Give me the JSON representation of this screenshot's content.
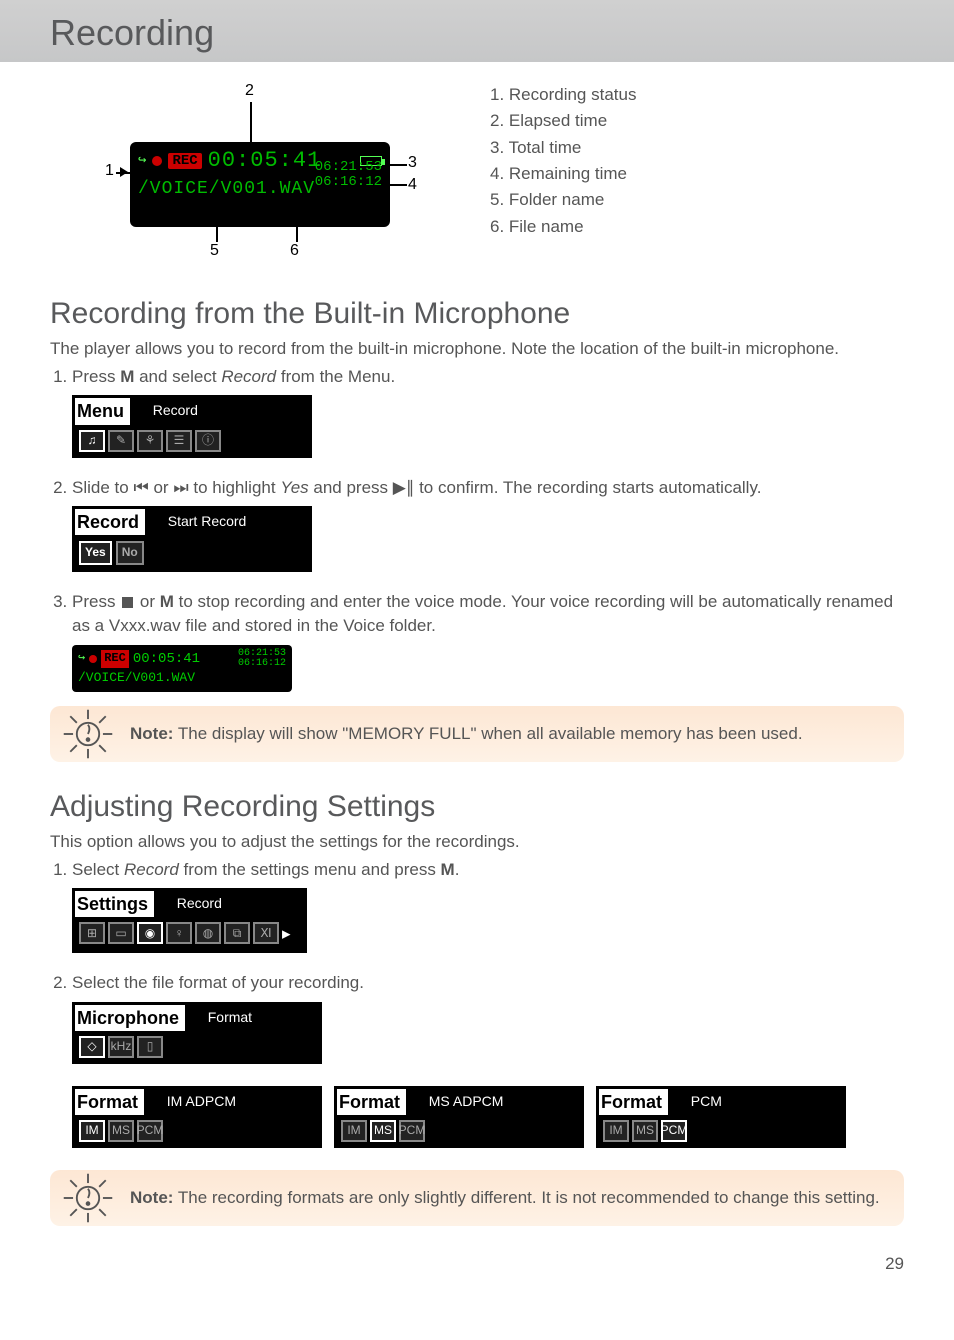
{
  "page": {
    "title": "Recording",
    "number": "29"
  },
  "diagram": {
    "callouts": {
      "c1": "1",
      "c2": "2",
      "c3": "3",
      "c4": "4",
      "c5": "5",
      "c6": "6"
    },
    "lcd": {
      "rec_badge": "REC",
      "elapsed": "00:05:41",
      "total": "06:21:53",
      "remaining": "06:16:12",
      "path": "/VOICE/V001.WAV"
    },
    "legend": {
      "i1": "1.  Recording status",
      "i2": "2.  Elapsed time",
      "i3": "3.  Total time",
      "i4": "4.  Remaining time",
      "i5": "5.  Folder name",
      "i6": "6.  File name"
    }
  },
  "section1": {
    "heading": "Recording from the Built-in Microphone",
    "intro": "The player allows you to record from the built-in microphone. Note the location of the built-in microphone.",
    "step1_a": "Press ",
    "step1_b": "M",
    "step1_c": " and select ",
    "step1_d": "Record",
    "step1_e": " from the Menu.",
    "menu_tab": "Menu",
    "menu_right": "Record",
    "step2_a": "Slide to ",
    "step2_prev": "⏮",
    "step2_or": " or ",
    "step2_next": "⏭",
    "step2_b": "  to highlight ",
    "step2_yes": "Yes",
    "step2_c": " and press ",
    "step2_play": "▶∥",
    "step2_d": " to confirm. The recording starts automatically.",
    "record_tab": "Record",
    "record_right": "Start Record",
    "yes_label": "Yes",
    "no_label": "No",
    "step3_a": "Press ",
    "step3_b": "  or ",
    "step3_m": "M",
    "step3_c": " to stop recording and enter the voice mode. Your voice recording will be automatically renamed as a Vxxx.wav file and stored in the Voice folder.",
    "note1_a": "Note:",
    "note1_b": " The display will show \"MEMORY FULL\" when all available memory has been used."
  },
  "section2": {
    "heading": "Adjusting Recording Settings",
    "intro": "This option allows you to adjust the settings for the recordings.",
    "step1_a": "Select ",
    "step1_b": "Record",
    "step1_c": " from the settings menu and press ",
    "step1_d": "M",
    "step1_e": ".",
    "settings_tab": "Settings",
    "settings_right": "Record",
    "step2": "Select the file format of your recording.",
    "mic_tab": "Microphone",
    "mic_right": "Format",
    "f_tab": "Format",
    "f1_right": "IM ADPCM",
    "f2_right": "MS ADPCM",
    "f3_right": "PCM",
    "fi_im": "IM",
    "fi_ms": "MS",
    "fi_pcm": "PCM",
    "note2_a": "Note:",
    "note2_b": " The recording formats are only slightly different. It is not recommended to change this setting."
  }
}
